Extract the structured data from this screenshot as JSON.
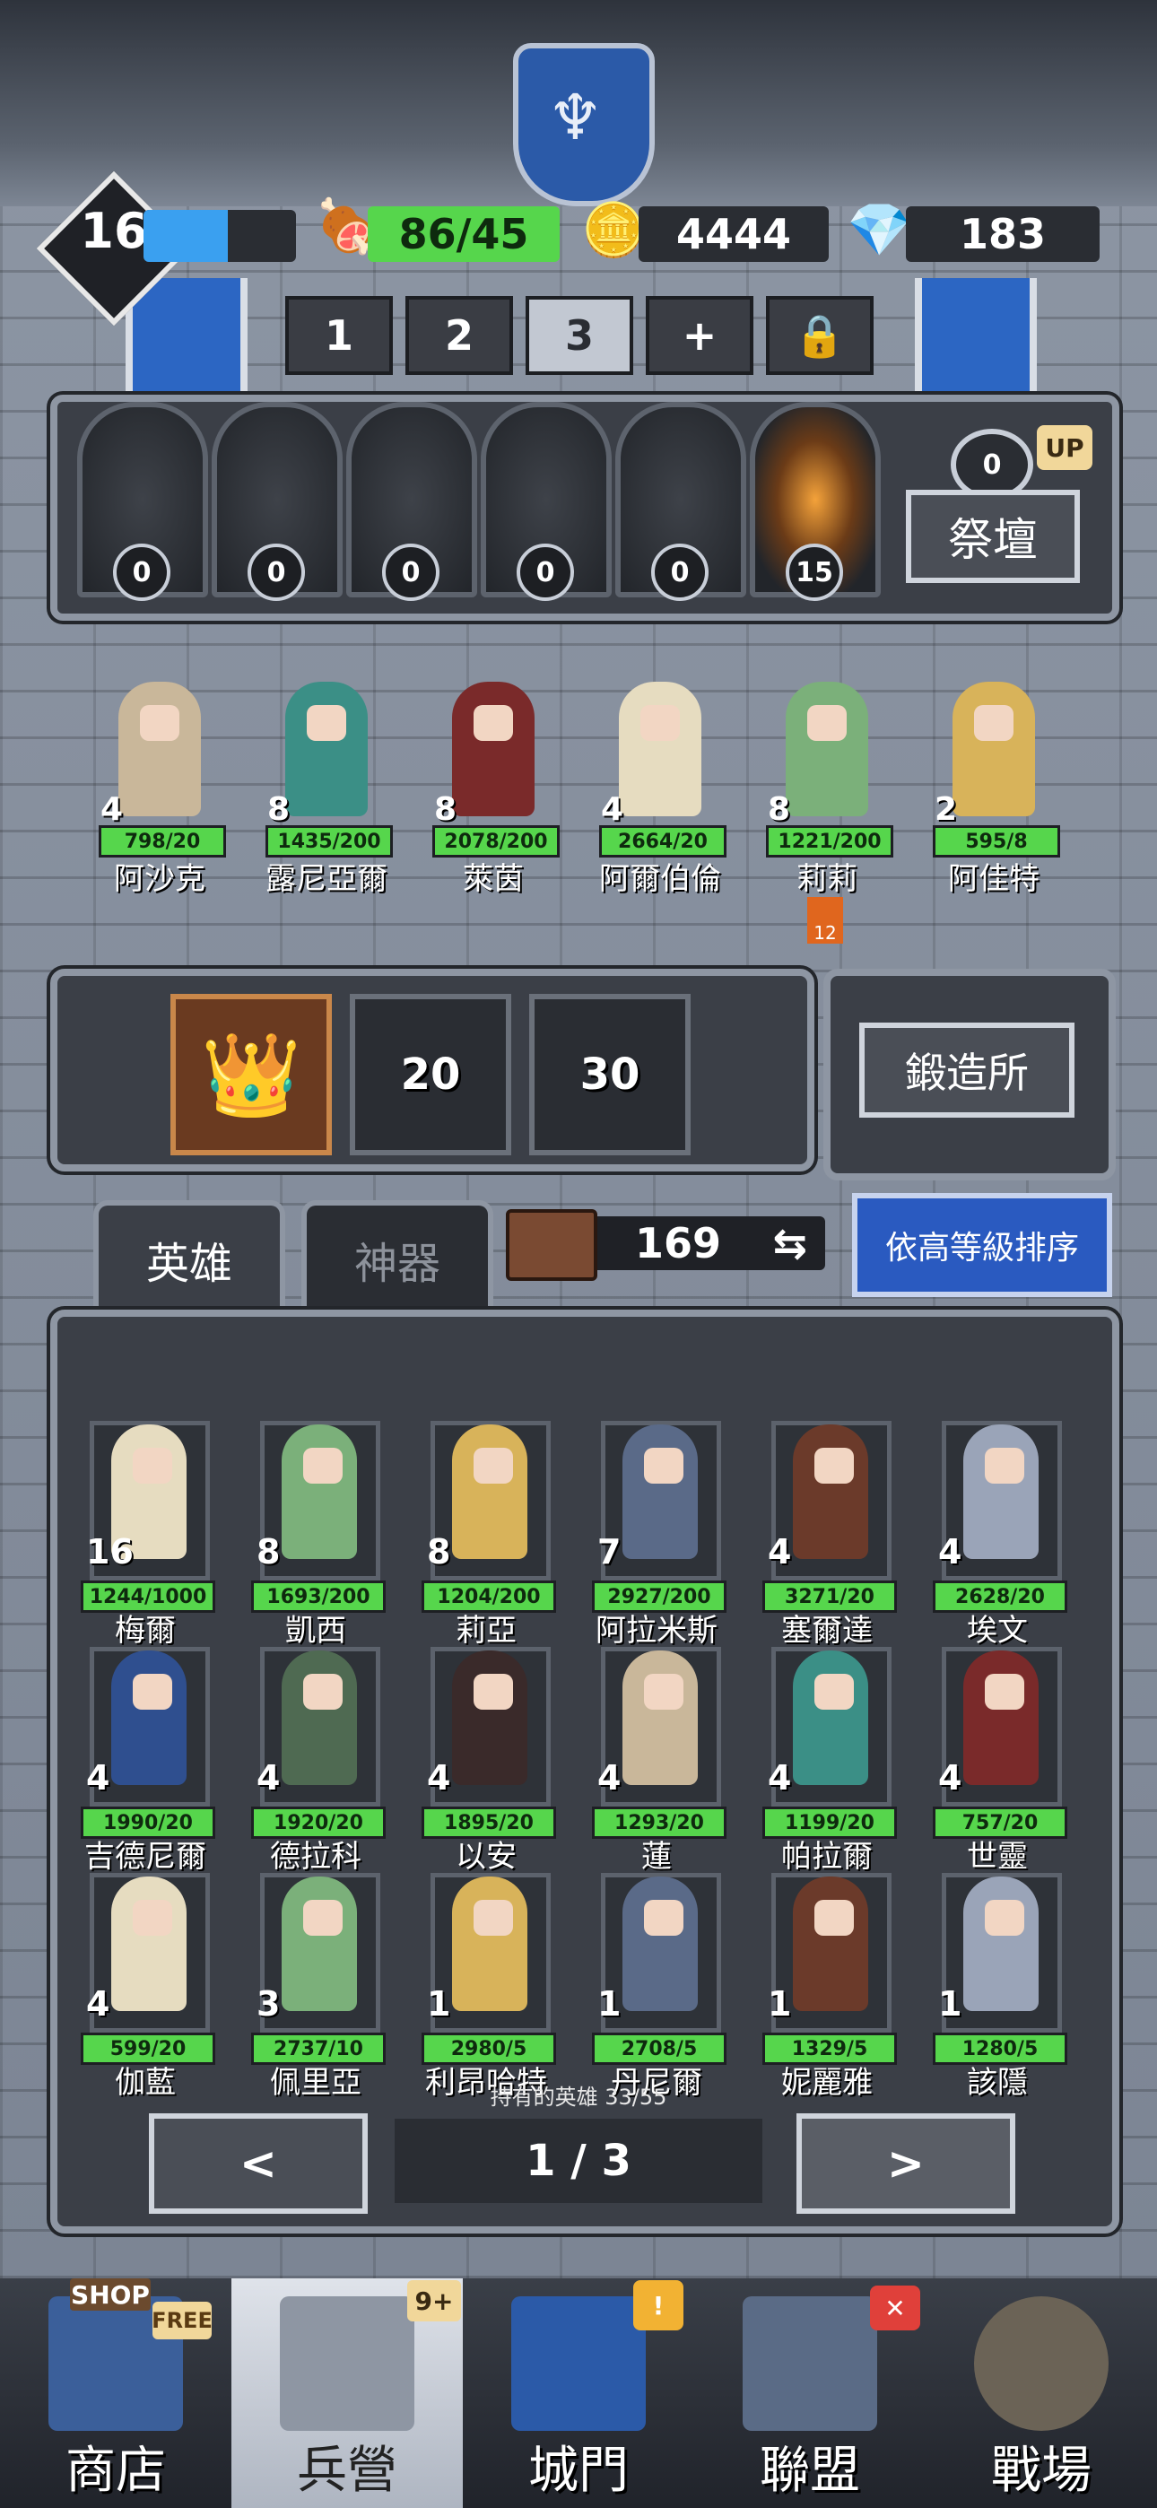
{
  "status": {
    "level": "16",
    "level_progress": 0.55,
    "food": "86/45",
    "gold": "4444",
    "gems": "183"
  },
  "team_tabs": [
    "1",
    "2",
    "3",
    "+"
  ],
  "team_tabs_active": "3",
  "altar": {
    "slots": [
      "0",
      "0",
      "0",
      "0",
      "0",
      "15"
    ],
    "button_label": "祭壇",
    "laurel_count": "0",
    "up_badge": "UP"
  },
  "formation": [
    {
      "star": "4",
      "hp": "798/20",
      "name": "阿沙克"
    },
    {
      "star": "8",
      "hp": "1435/200",
      "name": "露尼亞爾"
    },
    {
      "star": "8",
      "hp": "2078/200",
      "name": "萊茵"
    },
    {
      "star": "4",
      "hp": "2664/20",
      "name": "阿爾伯倫"
    },
    {
      "star": "8",
      "hp": "1221/200",
      "name": "莉莉"
    },
    {
      "star": "2",
      "hp": "595/8",
      "name": "阿佳特"
    }
  ],
  "formation_badge": "12",
  "equipment": {
    "slots": [
      "",
      "20",
      "30"
    ]
  },
  "forge_label": "鍛造所",
  "tabs": {
    "heroes": "英雄",
    "artifacts": "神器"
  },
  "book_count": "169",
  "sort_label": "依高等級排序",
  "roster": [
    {
      "star": "16",
      "hp": "1244/1000",
      "name": "梅爾"
    },
    {
      "star": "8",
      "hp": "1693/200",
      "name": "凱西"
    },
    {
      "star": "8",
      "hp": "1204/200",
      "name": "莉亞"
    },
    {
      "star": "7",
      "hp": "2927/200",
      "name": "阿拉米斯"
    },
    {
      "star": "4",
      "hp": "3271/20",
      "name": "塞爾達"
    },
    {
      "star": "4",
      "hp": "2628/20",
      "name": "埃文"
    },
    {
      "star": "4",
      "hp": "1990/20",
      "name": "吉德尼爾"
    },
    {
      "star": "4",
      "hp": "1920/20",
      "name": "德拉科"
    },
    {
      "star": "4",
      "hp": "1895/20",
      "name": "以安"
    },
    {
      "star": "4",
      "hp": "1293/20",
      "name": "蓮"
    },
    {
      "star": "4",
      "hp": "1199/20",
      "name": "帕拉爾"
    },
    {
      "star": "4",
      "hp": "757/20",
      "name": "世靈"
    },
    {
      "star": "4",
      "hp": "599/20",
      "name": "伽藍"
    },
    {
      "star": "3",
      "hp": "2737/10",
      "name": "佩里亞"
    },
    {
      "star": "1",
      "hp": "2980/5",
      "name": "利昂哈特"
    },
    {
      "star": "1",
      "hp": "2708/5",
      "name": "丹尼爾"
    },
    {
      "star": "1",
      "hp": "1329/5",
      "name": "妮麗雅"
    },
    {
      "star": "1",
      "hp": "1280/5",
      "name": "該隱"
    }
  ],
  "owned_text": "持有的英雄 33/55",
  "pagination": {
    "prev": "<",
    "index": "1 / 3",
    "next": ">"
  },
  "nav": [
    {
      "label": "商店",
      "badge_top": "SHOP",
      "badge_side": "FREE"
    },
    {
      "label": "兵營",
      "badge_side": "9+"
    },
    {
      "label": "城門",
      "badge_side": "!"
    },
    {
      "label": "聯盟",
      "badge_side": "✕"
    },
    {
      "label": "戰場"
    }
  ],
  "colors": {
    "hp_green": "#56d64c",
    "sort_blue": "#2a5ac0",
    "xp_blue": "#3aa0f0"
  }
}
